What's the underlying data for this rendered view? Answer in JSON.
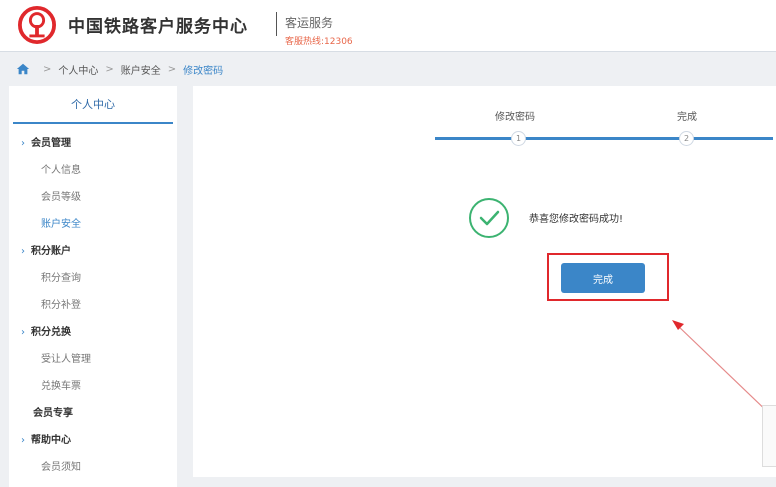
{
  "header": {
    "brand": "中国铁路客户服务中心",
    "subtitle": "客运服务",
    "hotline": "客服热线:12306"
  },
  "breadcrumb": {
    "items": [
      "个人中心",
      "账户安全"
    ],
    "current": "修改密码",
    "separator": ">"
  },
  "sidebar": {
    "title": "个人中心",
    "groups": [
      {
        "label": "会员管理",
        "arrow": "›",
        "items": [
          "个人信息",
          "会员等级",
          "账户安全"
        ]
      },
      {
        "label": "积分账户",
        "arrow": "›",
        "items": [
          "积分查询",
          "积分补登"
        ]
      },
      {
        "label": "积分兑换",
        "arrow": "›",
        "items": [
          "受让人管理",
          "兑换车票"
        ]
      },
      {
        "label": "会员专享",
        "arrow": "",
        "items": []
      },
      {
        "label": "帮助中心",
        "arrow": "›",
        "items": [
          "会员须知"
        ]
      }
    ],
    "active_item": "账户安全"
  },
  "steps": [
    {
      "label": "修改密码",
      "number": "1"
    },
    {
      "label": "完成",
      "number": "2"
    }
  ],
  "result": {
    "message": "恭喜您修改密码成功!",
    "done_button": "完成"
  },
  "colors": {
    "accent": "#3b86c8",
    "brand_red": "#e0282c",
    "hotline": "#e8674a",
    "success": "#3cb371"
  }
}
